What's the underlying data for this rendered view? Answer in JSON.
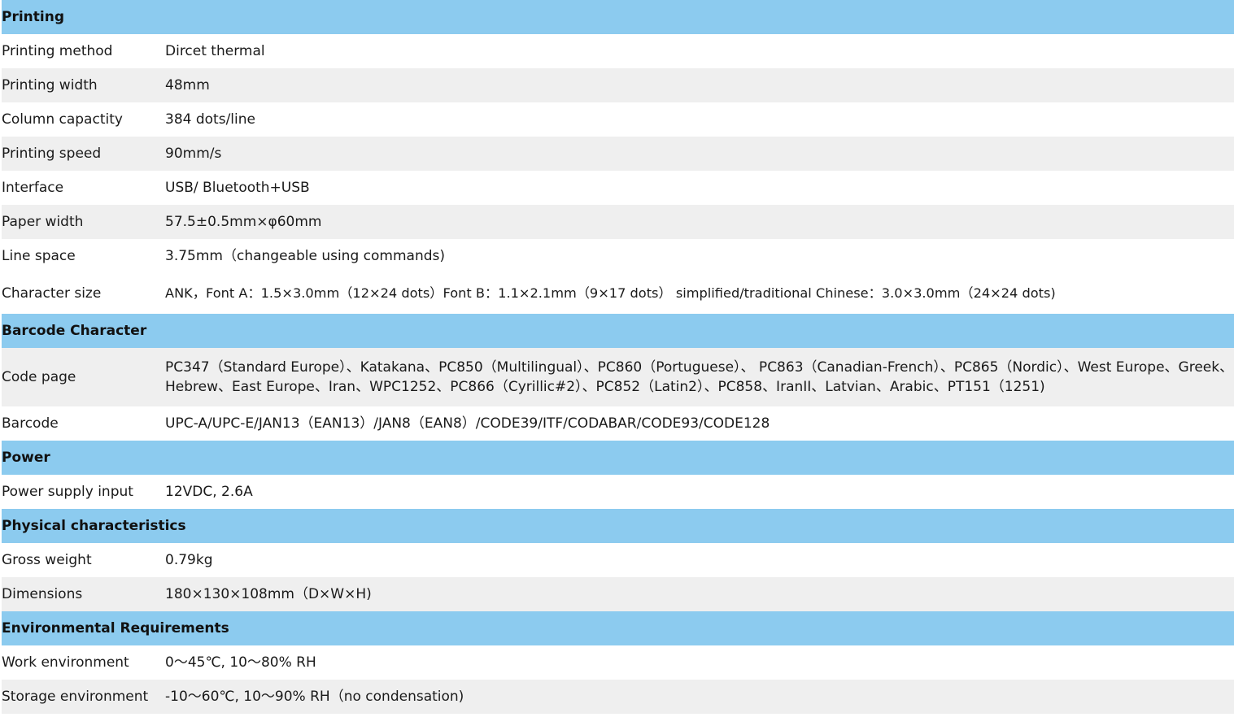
{
  "sections": [
    {
      "title": "Printing",
      "rows": [
        {
          "label": "Printing method",
          "value": "Dircet thermal"
        },
        {
          "label": "Printing width",
          "value": "48mm"
        },
        {
          "label": "Column capactity",
          "value": "384 dots/line"
        },
        {
          "label": "Printing speed",
          "value": "90mm/s"
        },
        {
          "label": "Interface",
          "value": " USB/ Bluetooth+USB"
        },
        {
          "label": "Paper width",
          "value": "57.5±0.5mm×φ60mm"
        },
        {
          "label": "Line space",
          "value": "3.75mm（changeable using commands)"
        },
        {
          "label": "Character size",
          "value": "ANK，Font A：1.5×3.0mm（12×24 dots）Font B：1.1×2.1mm（9×17 dots） simplified/traditional Chinese：3.0×3.0mm（24×24 dots)"
        }
      ]
    },
    {
      "title": "Barcode Character",
      "rows": [
        {
          "label": "Code page",
          "value": "PC347（Standard Europe）、Katakana、PC850（Multilingual）、PC860（Portuguese）、 PC863（Canadian-French）、PC865（Nordic）、West Europe、Greek、Hebrew、East Europe、Iran、WPC1252、PC866（Cyrillic#2）、PC852（Latin2）、PC858、IranII、Latvian、Arabic、PT151（1251)"
        },
        {
          "label": "Barcode",
          "value": "UPC-A/UPC-E/JAN13（EAN13）/JAN8（EAN8）/CODE39/ITF/CODABAR/CODE93/CODE128"
        }
      ]
    },
    {
      "title": "Power",
      "rows": [
        {
          "label": "Power supply input",
          "value": "12VDC, 2.6A"
        }
      ]
    },
    {
      "title": "Physical characteristics",
      "rows": [
        {
          "label": "Gross weight",
          "value": "0.79kg"
        },
        {
          "label": "Dimensions",
          "value": "180×130×108mm（D×W×H)"
        }
      ]
    },
    {
      "title": "Environmental Requirements",
      "rows": [
        {
          "label": "Work environment",
          "value": "0～45℃, 10～80% RH"
        },
        {
          "label": "Storage environment",
          "value": "-10～60℃, 10～90% RH（no condensation)"
        }
      ]
    }
  ],
  "colors": {
    "section_header_bg": "#8ccbef",
    "alt_row_bg": "#efefef",
    "row_bg": "#ffffff"
  }
}
